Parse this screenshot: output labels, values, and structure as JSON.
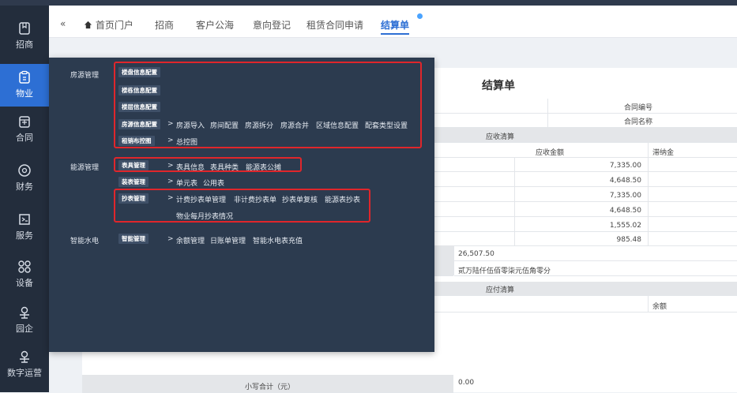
{
  "sidebar": {
    "items": [
      {
        "label": "招商",
        "icon": "bookmark-icon"
      },
      {
        "label": "物业",
        "icon": "clipboard-icon"
      },
      {
        "label": "合同",
        "icon": "contract-icon"
      },
      {
        "label": "财务",
        "icon": "target-icon"
      },
      {
        "label": "服务",
        "icon": "service-icon"
      },
      {
        "label": "设备",
        "icon": "grid-icon"
      },
      {
        "label": "园企",
        "icon": "person-icon"
      },
      {
        "label": "数字运营",
        "icon": "person-icon"
      }
    ],
    "active_color": "#2d6fd4"
  },
  "tabs": {
    "collapse": "«",
    "home": "首页门户",
    "items": [
      "招商",
      "客户公海",
      "意向登记",
      "租赁合同申请",
      "结算单"
    ]
  },
  "document": {
    "title": "结算单",
    "contract_no_label": "合同编号",
    "contract_name_label": "合同名称",
    "receivable_section": "应收清算",
    "receivable_amount_header": "应收金额",
    "late_fee_header": "滞纳金",
    "amounts": [
      "7,335.00",
      "4,648.50",
      "7,335.00",
      "4,648.50",
      "1,555.02",
      "985.48"
    ],
    "total_value": "26,507.50",
    "total_capital": "贰万陆仟伍佰零柒元伍角零分",
    "payable_section": "应付清算",
    "balance_header": "余额",
    "subtotal_label": "小写合计（元）",
    "subtotal_value": "0.00"
  },
  "menu": {
    "groups": [
      {
        "category": "房源管理",
        "rows": [
          {
            "tag": "楼盘信息配置",
            "links": []
          },
          {
            "tag": "楼栋信息配置",
            "links": []
          },
          {
            "tag": "楼层信息配置",
            "links": []
          },
          {
            "tag": "房源信息配置",
            "links": [
              "房源导入",
              "房间配置",
              "房源拆分",
              "房源合并",
              "区域信息配置",
              "配套类型设置"
            ]
          },
          {
            "tag": "租销布控图",
            "links": [
              "总控图"
            ]
          }
        ]
      },
      {
        "category": "能源管理",
        "rows": [
          {
            "tag": "表具管理",
            "links": [
              "表具信息",
              "表具种类",
              "能源表公摊"
            ]
          },
          {
            "tag": "装表管理",
            "links": [
              "单元表",
              "公用表"
            ]
          },
          {
            "tag": "抄表管理",
            "links": [
              "计费抄表单管理",
              "非计费抄表单",
              "抄表单复核",
              "能源表抄表"
            ]
          },
          {
            "tag": "",
            "links": [
              "物业每月抄表情况"
            ]
          }
        ]
      },
      {
        "category": "智能水电",
        "rows": [
          {
            "tag": "智能管理",
            "links": [
              "余额管理",
              "日账单管理",
              "智能水电表充值"
            ]
          }
        ]
      }
    ],
    "arrow": ">",
    "highlight_color": "#e0262b"
  }
}
